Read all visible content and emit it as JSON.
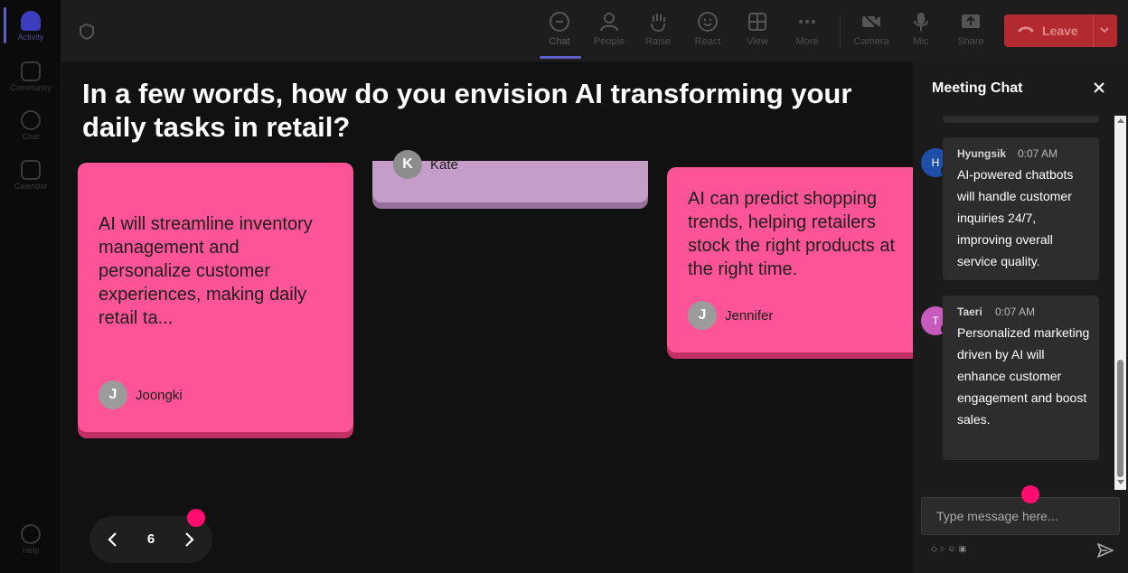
{
  "rail": {
    "items": [
      {
        "label": "Activity",
        "icon": "bell-icon"
      },
      {
        "label": "Community",
        "icon": "community-icon"
      },
      {
        "label": "Chat",
        "icon": "chat-icon"
      },
      {
        "label": "Calendar",
        "icon": "calendar-icon"
      }
    ],
    "help": {
      "label": "Help",
      "icon": "help-icon"
    }
  },
  "toolbar": {
    "items": [
      {
        "label": "Chat",
        "icon": "chat-icon"
      },
      {
        "label": "People",
        "icon": "people-icon"
      },
      {
        "label": "Raise",
        "icon": "raise-hand-icon"
      },
      {
        "label": "React",
        "icon": "smile-icon"
      },
      {
        "label": "View",
        "icon": "grid-icon"
      },
      {
        "label": "More",
        "icon": "more-icon"
      },
      {
        "label": "Camera",
        "icon": "camera-off-icon"
      },
      {
        "label": "Mic",
        "icon": "mic-icon"
      },
      {
        "label": "Share",
        "icon": "share-icon"
      }
    ],
    "leave_label": "Leave"
  },
  "stage": {
    "question": "In a few words, how do you envision AI transforming your daily tasks in retail?",
    "notes": [
      {
        "text": "AI will streamline inventory management and personalize customer experiences, making daily retail ta...",
        "initial": "J",
        "author": "Joongki"
      },
      {
        "text": "",
        "initial": "K",
        "author": "Kate"
      },
      {
        "text": "AI can predict shopping trends, helping retailers stock the right products at the right time.",
        "initial": "J",
        "author": "Jennifer"
      }
    ],
    "pager": {
      "page": "6"
    }
  },
  "chat": {
    "title": "Meeting Chat",
    "messages": [
      {
        "initial": "H",
        "name": "Hyungsik",
        "time": "0:07 AM",
        "body": "AI-powered chatbots will handle customer inquiries 24/7, improving overall service quality.",
        "avatar_color": "#1d4fa8"
      },
      {
        "initial": "T",
        "name": "Taeri",
        "time": "0:07 AM",
        "body": "Personalized marketing driven by AI will enhance customer engagement and boost sales.",
        "avatar_color": "#c65bbd"
      }
    ],
    "input_placeholder": "Type message here..."
  },
  "colors": {
    "note_pink": "#fd5498",
    "note_purple": "#c49dc8",
    "leave_red": "#b22a2f",
    "accent": "#5b5fc7",
    "pointer_dot": "#ff0d6e"
  }
}
